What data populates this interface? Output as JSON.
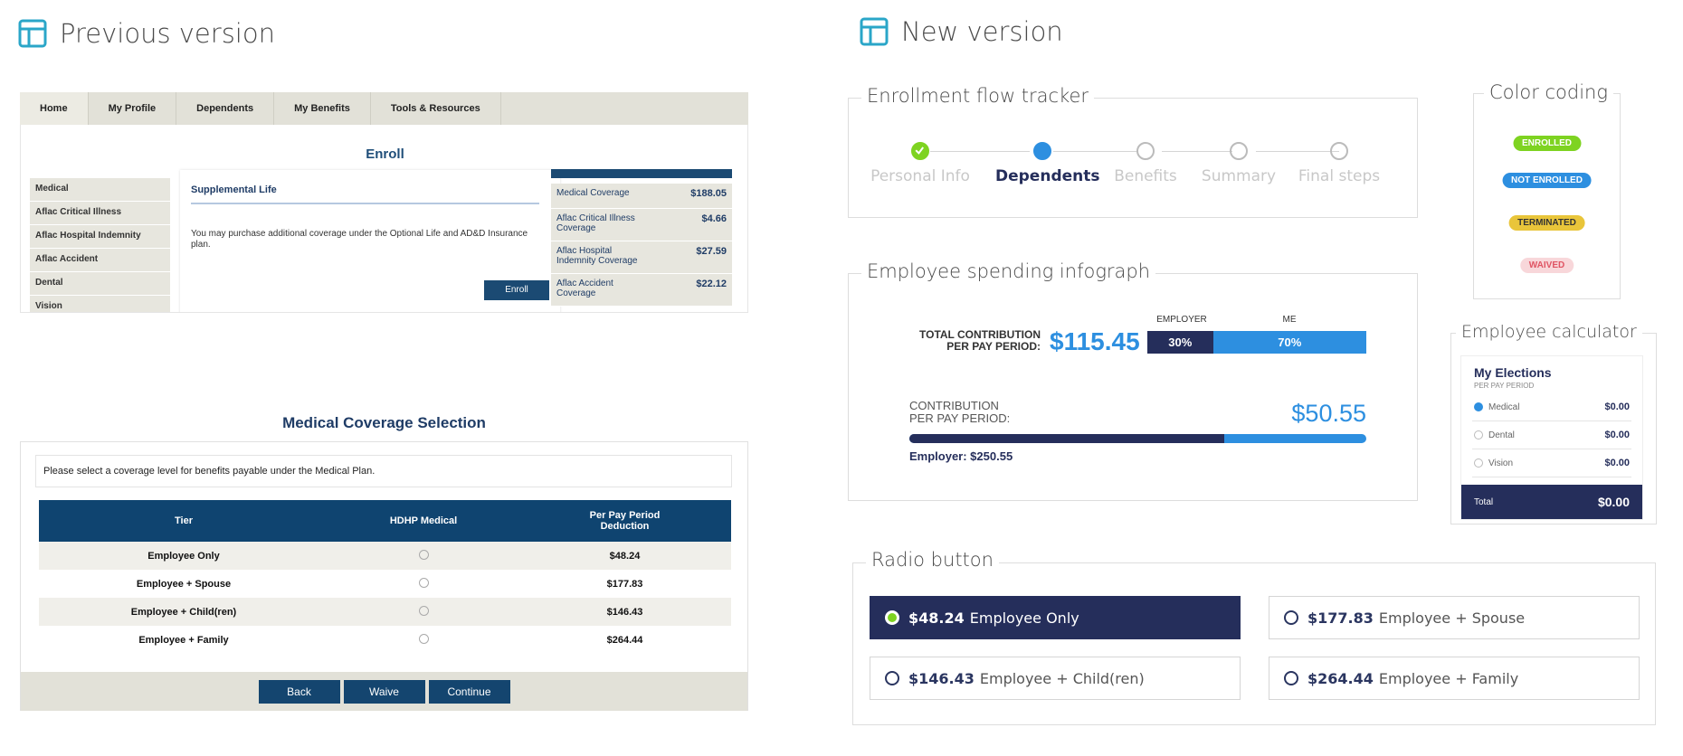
{
  "previous": {
    "title": "Previous version",
    "nav": [
      "Home",
      "My Profile",
      "Dependents",
      "My Benefits",
      "Tools & Resources"
    ],
    "enroll_title": "Enroll",
    "side_items": [
      "Medical",
      "Aflac Critical Illness",
      "Aflac Hospital Indemnity",
      "Aflac Accident",
      "Dental",
      "Vision"
    ],
    "panel_title": "Supplemental Life",
    "panel_text": "You may purchase additional coverage under the Optional Life and AD&D Insurance plan.",
    "enroll_button": "Enroll",
    "costs": [
      {
        "label": "Medical Coverage",
        "value": "$188.05"
      },
      {
        "label": "Aflac Critical Illness Coverage",
        "value": "$4.66"
      },
      {
        "label": "Aflac Hospital Indemnity Coverage",
        "value": "$27.59"
      },
      {
        "label": "Aflac Accident Coverage",
        "value": "$22.12"
      }
    ],
    "medical_title": "Medical Coverage Selection",
    "medical_msg": "Please select a coverage level for benefits payable under the Medical Plan.",
    "table_headers": [
      "Tier",
      "HDHP Medical",
      "Per Pay Period Deduction"
    ],
    "table_rows": [
      {
        "tier": "Employee Only",
        "deduction": "$48.24"
      },
      {
        "tier": "Employee + Spouse",
        "deduction": "$177.83"
      },
      {
        "tier": "Employee + Child(ren)",
        "deduction": "$146.43"
      },
      {
        "tier": "Employee + Family",
        "deduction": "$264.44"
      }
    ],
    "buttons": [
      "Back",
      "Waive",
      "Continue"
    ]
  },
  "new": {
    "title": "New version",
    "tracker": {
      "legend": "Enrollment flow tracker",
      "steps": [
        "Personal Info",
        "Dependents",
        "Benefits",
        "Summary",
        "Final steps"
      ],
      "status": [
        "done",
        "active",
        "todo",
        "todo",
        "todo"
      ]
    },
    "color_coding": {
      "legend": "Color coding",
      "badges": [
        {
          "label": "ENROLLED",
          "bg": "#7ed321",
          "fg": "#ffffff"
        },
        {
          "label": "NOT ENROLLED",
          "bg": "#2d8fe0",
          "fg": "#ffffff"
        },
        {
          "label": "TERMINATED",
          "bg": "#e9c53a",
          "fg": "#333333"
        },
        {
          "label": "WAIVED",
          "bg": "#f8d7da",
          "fg": "#e05564"
        }
      ]
    },
    "infograph": {
      "legend": "Employee spending infograph",
      "total_label_1": "TOTAL CONTRIBUTION",
      "total_label_2": "PER PAY PERIOD:",
      "total_value": "$115.45",
      "employer_head": "EMPLOYER",
      "me_head": "ME",
      "employer_pct": "30%",
      "me_pct": "70%",
      "employer_share": 0.3,
      "contrib_label_1": "CONTRIBUTION",
      "contrib_label_2": "PER PAY PERIOD:",
      "contrib_value": "$50.55",
      "contrib_fill": 0.69,
      "employer_text": "Employer: $250.55"
    },
    "calculator": {
      "legend": "Employee calculator",
      "title": "My Elections",
      "subtitle": "PER PAY PERIOD",
      "rows": [
        {
          "label": "Medical",
          "value": "$0.00",
          "selected": true
        },
        {
          "label": "Dental",
          "value": "$0.00",
          "selected": false
        },
        {
          "label": "Vision",
          "value": "$0.00",
          "selected": false
        }
      ],
      "total_label": "Total",
      "total_value": "$0.00"
    },
    "radio": {
      "legend": "Radio button",
      "options": [
        {
          "price": "$48.24",
          "label": "Employee Only",
          "selected": true
        },
        {
          "price": "$177.83",
          "label": "Employee + Spouse",
          "selected": false
        },
        {
          "price": "$146.43",
          "label": "Employee + Child(ren)",
          "selected": false
        },
        {
          "price": "$264.44",
          "label": "Employee + Family",
          "selected": false
        }
      ]
    },
    "colors": {
      "navy": "#252e5b",
      "blue": "#2d8fe0",
      "green": "#7ed321"
    }
  }
}
